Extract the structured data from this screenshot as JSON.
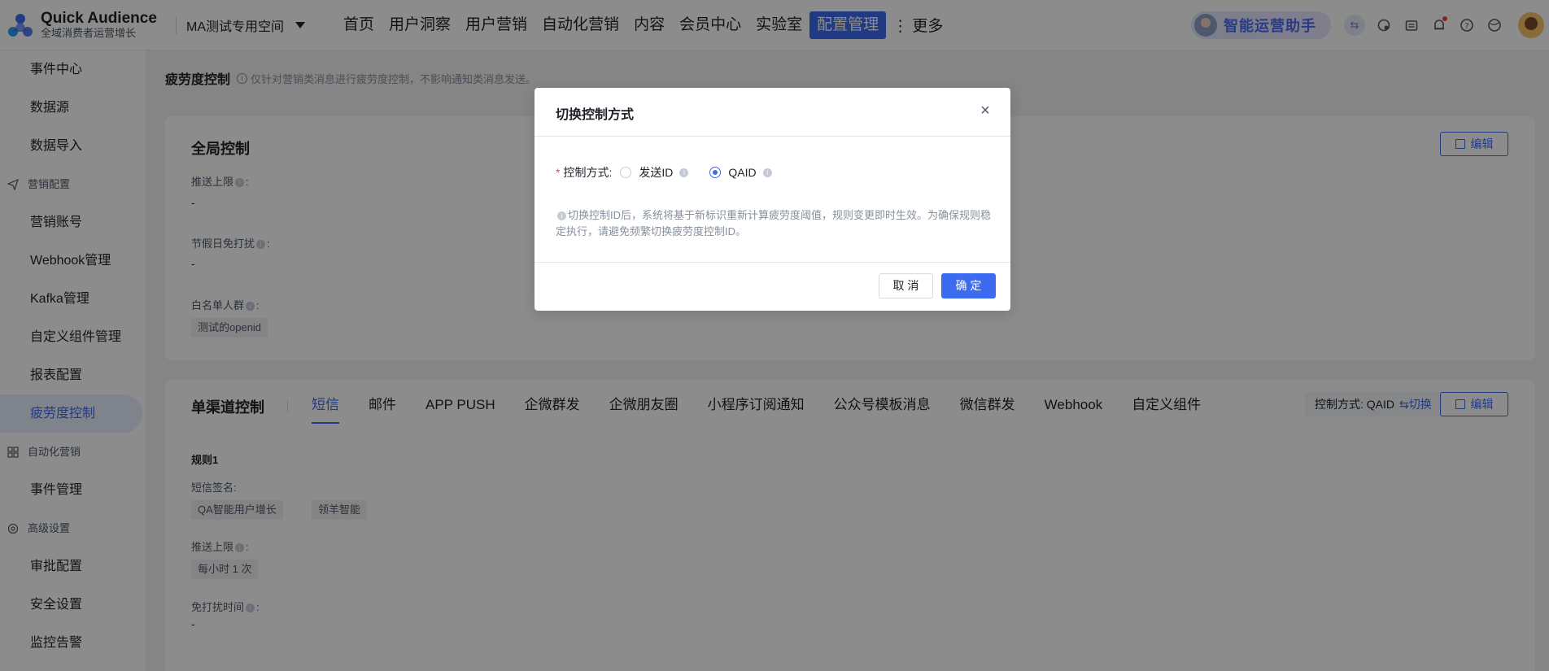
{
  "header": {
    "logo_title": "Quick Audience",
    "logo_sub": "全域消费者运营增长",
    "workspace": "MA测试专用空间",
    "nav": [
      "首页",
      "用户洞察",
      "用户营销",
      "自动化营销",
      "内容",
      "会员中心",
      "实验室",
      "配置管理"
    ],
    "nav_more": "⋮ 更多",
    "assistant": "智能运营助手"
  },
  "sidebar": {
    "items_top": [
      "事件中心",
      "数据源",
      "数据导入"
    ],
    "group_marketing": "营销配置",
    "items_marketing": [
      "营销账号",
      "Webhook管理",
      "Kafka管理",
      "自定义组件管理",
      "报表配置",
      "疲劳度控制"
    ],
    "group_auto": "自动化营销",
    "items_auto": [
      "事件管理"
    ],
    "group_advanced": "高级设置",
    "items_advanced": [
      "审批配置",
      "安全设置",
      "监控告警"
    ]
  },
  "page": {
    "title": "疲劳度控制",
    "tip": "仅针对营销类消息进行疲劳度控制，不影响通知类消息发送。"
  },
  "global_card": {
    "title": "全局控制",
    "edit": "编辑",
    "push_limit_label": "推送上限",
    "push_limit_value": "-",
    "holiday_label": "节假日免打扰",
    "holiday_value": "-",
    "whitelist_label": "白名单人群",
    "whitelist_tag": "测试的openid"
  },
  "channel_card": {
    "title": "单渠道控制",
    "tabs": [
      "短信",
      "邮件",
      "APP PUSH",
      "企微群发",
      "企微朋友圈",
      "小程序订阅通知",
      "公众号模板消息",
      "微信群发",
      "Webhook",
      "自定义组件"
    ],
    "mode_label": "控制方式: QAID",
    "mode_switch": "⇆切换",
    "edit": "编辑",
    "rule_title": "规则1",
    "sign_label": "短信签名:",
    "sign_tags": [
      "QA智能用户增长",
      "领羊智能"
    ],
    "push_limit_label": "推送上限",
    "push_limit_tag": "每小时 1 次",
    "dnd_label": "免打扰时间",
    "dnd_value": "-"
  },
  "modal": {
    "title": "切换控制方式",
    "field_label": "控制方式:",
    "option_send_id": "发送ID",
    "option_qaid": "QAID",
    "note": "切换控制ID后，系统将基于新标识重新计算疲劳度阈值，规则变更即时生效。为确保规则稳定执行，请避免频繁切换疲劳度控制ID。",
    "cancel": "取 消",
    "ok": "确 定"
  }
}
